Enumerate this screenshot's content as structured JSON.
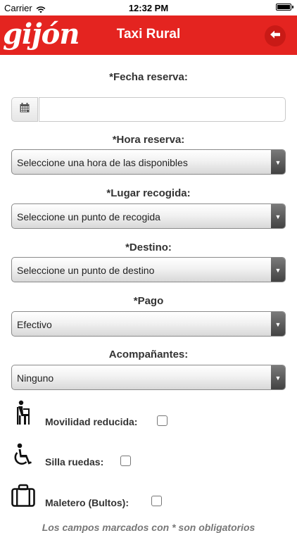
{
  "status_bar": {
    "carrier": "Carrier",
    "time": "12:32 PM"
  },
  "header": {
    "logo": "gijón",
    "title": "Taxi Rural"
  },
  "form": {
    "fecha_label": "*Fecha reserva:",
    "fecha_value": "",
    "hora_label": "*Hora reserva:",
    "hora_value": "Seleccione una hora de las disponibles",
    "recogida_label": "*Lugar recogida:",
    "recogida_value": "Seleccione un punto de recogida",
    "destino_label": "*Destino:",
    "destino_value": "Seleccione un punto de destino",
    "pago_label": "*Pago",
    "pago_value": "Efectivo",
    "acompanantes_label": "Acompañantes:",
    "acompanantes_value": "Ninguno",
    "movilidad_label": "Movilidad reducida:",
    "silla_label": "Silla ruedas:",
    "maletero_label": "Maletero (Bultos):",
    "footer_note": "Los campos marcados con * son obligatorios"
  },
  "icons": {
    "calendar": "calendar-icon",
    "back": "arrow-left-icon",
    "movilidad": "reduced-mobility-icon",
    "silla": "wheelchair-icon",
    "maletero": "suitcase-icon"
  },
  "colors": {
    "header_bg": "#e42420",
    "header_button": "#c91a16"
  }
}
